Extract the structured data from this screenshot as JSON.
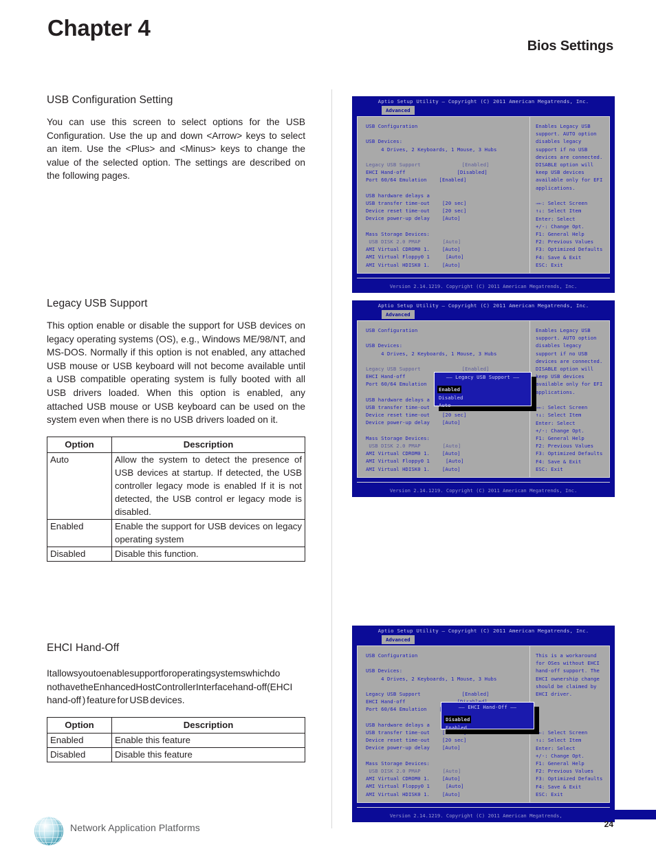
{
  "page": {
    "chapter": "Chapter 4",
    "section": "Bios Settings",
    "page_number": "24",
    "brand": "Network Application Platforms"
  },
  "sections": {
    "usb_config": {
      "heading": "USB Configuration Setting",
      "body": "You can use this screen to select options for the USB Configuration. Use the up and down <Arrow> keys to select an item. Use the <Plus> and <Minus> keys to change the value of the selected option. The settings are described on the following pages."
    },
    "legacy_usb": {
      "heading": "Legacy USB Support",
      "body": "This option enable or disable the support for USB devices on legacy operating systems (OS), e.g., Windows ME/98/NT, and MS-DOS. Normally if this option is not enabled, any attached USB mouse or USB keyboard will not become available until a USB compatible operating system is fully booted with all USB drivers loaded. When this option is enabled, any attached USB mouse or USB keyboard can be used on the system even when there is no USB drivers loaded on it.",
      "table": {
        "headers": [
          "Option",
          "Description"
        ],
        "rows": [
          [
            "Auto",
            "Allow the system to detect the presence of USB devices at startup. If detected, the USB controller legacy mode is enabled  If it is not detected, the USB control er legacy mode is disabled."
          ],
          [
            "Enabled",
            "Enable the support for USB devices on legacy operating system"
          ],
          [
            "Disabled",
            "Disable this function."
          ]
        ]
      }
    },
    "ehci_handoff": {
      "heading": "EHCI Hand-Off",
      "body": "Itallowsyoutoenablesupportforoperatingsystemswhichdo nothavetheEnhancedHostControllerInterfacehand-off(EHCI hand-off ) feature for USB devices.",
      "table": {
        "headers": [
          "Option",
          "Description"
        ],
        "rows": [
          [
            "Enabled",
            "Enable this feature"
          ],
          [
            "Disabled",
            "Disable this feature"
          ]
        ]
      }
    }
  },
  "bios": {
    "title": "Aptio Setup Utility – Copyright (C) 2011 American Megatrends, Inc.",
    "tab": "Advanced",
    "footer": "Version 2.14.1219. Copyright (C) 2011 American Megatrends, Inc.",
    "menu": {
      "usb_configuration": "USB Configuration",
      "usb_devices": "USB Devices:",
      "usb_devices_detail": "     4 Drives, 2 Keyboards, 1 Mouse, 3 Hubs",
      "legacy_usb_support": "Legacy USB Support",
      "legacy_usb_support_value": "[Enabled]",
      "ehci_hand_off": "EHCI Hand-off",
      "ehci_hand_off_value": "[Disabled]",
      "port_6064": "Port 60/64 Emulation",
      "port_6064_value": "[Enabled]",
      "usb_hw_delays": "USB hardware delays a",
      "usb_transfer_timeout": "USB transfer time-out",
      "usb_transfer_timeout_value": "[20 sec]",
      "device_reset_timeout": "Device reset time-out",
      "device_reset_timeout_value": "[20 sec]",
      "device_power_up_delay": "Device power-up delay",
      "device_power_up_delay_value": "[Auto]",
      "mass_storage_devices": "Mass Storage Devices:",
      "usb_disk": " USB DISK 2.0 PMAP",
      "usb_disk_value": "[Auto]",
      "ami_cdrom": "AMI Virtual CDROM0 1.",
      "ami_cdrom_value": "[Auto]",
      "ami_floppy": "AMI Virtual Floppy0 1",
      "ami_floppy_value": "[Auto]",
      "ami_hdisk": "AMI Virtual HDISK0 1.",
      "ami_hdisk_value": "[Auto]"
    },
    "help_legacy": "Enables Legacy USB support. AUTO option disables legacy support if no USB devices are connected. DISABLE option will keep USB devices available only for EFI applications.",
    "help_ehci": "This is a workaround for OSes without EHCI hand-off support. The EHCI ownership change should be claimed by EHCI driver.",
    "navkeys": [
      "→←: Select Screen",
      "↑↓: Select Item",
      "Enter: Select",
      "+/-: Change Opt.",
      "F1: General Help",
      "F2: Previous Values",
      "F3: Optimized Defaults",
      "F4: Save & Exit",
      "ESC: Exit"
    ],
    "popup_legacy": {
      "title": "Legacy USB Support",
      "items": [
        "Enabled",
        "Disabled",
        "Auto"
      ],
      "selected": "Enabled"
    },
    "popup_ehci": {
      "title": "EHCI Hand-Off",
      "items": [
        "Disabled",
        "Enabled"
      ],
      "selected": "Disabled"
    }
  },
  "colors": {
    "bios_bg": "#0b0b97",
    "bios_panel": "#a9a9a9",
    "bios_text": "#1b1bbb"
  }
}
